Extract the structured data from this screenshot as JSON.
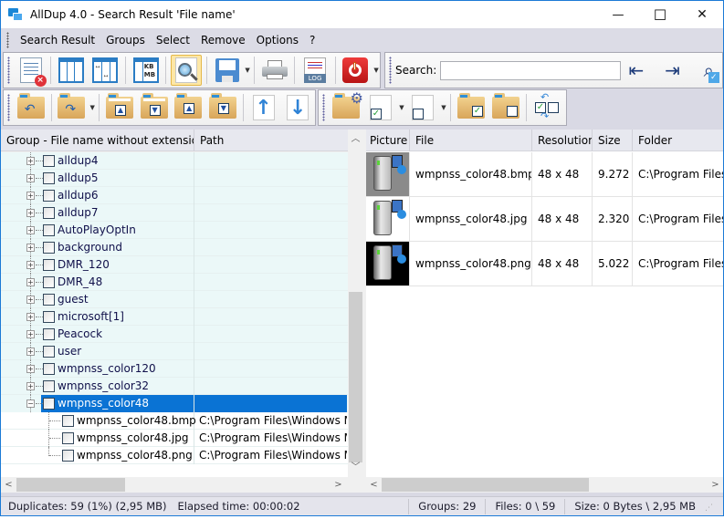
{
  "window": {
    "title": "AllDup 4.0 - Search Result 'File name'",
    "controls": {
      "minimize": "—",
      "maximize": "☐",
      "close": "✕"
    }
  },
  "menu": {
    "items": [
      "Search Result",
      "Groups",
      "Select",
      "Remove",
      "Options",
      "?"
    ]
  },
  "toolbar1": {
    "buttons": [
      {
        "name": "close-search-result",
        "icon": "document-delete-icon"
      },
      {
        "name": "columns",
        "icon": "columns-icon"
      },
      {
        "name": "auto-column-width",
        "icon": "column-width-icon"
      },
      {
        "name": "size-unit",
        "icon": "kb-mb-icon",
        "label_top": "KB",
        "label_bottom": "MB"
      },
      {
        "name": "preview",
        "icon": "magnifier-document-icon",
        "active": true
      },
      {
        "name": "save",
        "icon": "floppy-disk-icon",
        "dropdown": true
      },
      {
        "name": "print",
        "icon": "printer-icon"
      },
      {
        "name": "log",
        "icon": "log-icon",
        "label": "LOG"
      },
      {
        "name": "stop",
        "icon": "power-icon",
        "dropdown": true
      }
    ],
    "search_label": "Search:",
    "search_value": "",
    "search_buttons": [
      {
        "name": "find-previous",
        "icon": "binoculars-left-icon"
      },
      {
        "name": "find-next",
        "icon": "binoculars-right-icon"
      },
      {
        "name": "find-select",
        "icon": "binoculars-check-icon"
      }
    ]
  },
  "toolbar2": {
    "buttons": [
      {
        "name": "undo",
        "icon": "folder-undo-icon"
      },
      {
        "name": "redo",
        "icon": "folder-redo-icon",
        "dropdown": true
      },
      {
        "name": "first-group",
        "icon": "folder-first-icon"
      },
      {
        "name": "last-group",
        "icon": "folder-last-icon"
      },
      {
        "name": "previous-group",
        "icon": "folder-up-icon"
      },
      {
        "name": "next-group",
        "icon": "folder-down-icon"
      },
      {
        "name": "move-up",
        "icon": "arrow-up-icon"
      },
      {
        "name": "move-down",
        "icon": "arrow-down-icon"
      }
    ],
    "buttons2": [
      {
        "name": "group-settings",
        "icon": "folder-gear-icon"
      },
      {
        "name": "select-files",
        "icon": "file-check-icon",
        "dropdown": true
      },
      {
        "name": "deselect-files",
        "icon": "file-uncheck-icon",
        "dropdown": true
      },
      {
        "name": "select-all-groups",
        "icon": "folder-check-icon"
      },
      {
        "name": "deselect-all-groups",
        "icon": "folder-uncheck-icon"
      },
      {
        "name": "invert-selection",
        "icon": "invert-selection-icon"
      }
    ]
  },
  "left_pane": {
    "columns": [
      "Group - File name without extension",
      "Path"
    ],
    "groups": [
      {
        "label": "alldup4"
      },
      {
        "label": "alldup5"
      },
      {
        "label": "alldup6"
      },
      {
        "label": "alldup7"
      },
      {
        "label": "AutoPlayOptIn"
      },
      {
        "label": "background"
      },
      {
        "label": "DMR_120"
      },
      {
        "label": "DMR_48"
      },
      {
        "label": "guest"
      },
      {
        "label": "microsoft[1]"
      },
      {
        "label": "Peacock"
      },
      {
        "label": "user"
      },
      {
        "label": "wmpnss_color120"
      },
      {
        "label": "wmpnss_color32"
      },
      {
        "label": "wmpnss_color48",
        "expanded": true,
        "selected": true
      }
    ],
    "children": [
      {
        "label": "wmpnss_color48.bmp",
        "path": "C:\\Program Files\\Windows Me"
      },
      {
        "label": "wmpnss_color48.jpg",
        "path": "C:\\Program Files\\Windows Me"
      },
      {
        "label": "wmpnss_color48.png",
        "path": "C:\\Program Files\\Windows Me"
      }
    ]
  },
  "right_pane": {
    "columns": [
      "Picture",
      "File",
      "Resolution",
      "Size",
      "Folder"
    ],
    "rows": [
      {
        "file": "wmpnss_color48.bmp",
        "resolution": "48 x 48",
        "size": "9.272",
        "folder": "C:\\Program Files\\",
        "thumb_bg": "#8a8a8a"
      },
      {
        "file": "wmpnss_color48.jpg",
        "resolution": "48 x 48",
        "size": "2.320",
        "folder": "C:\\Program Files\\",
        "thumb_bg": "#ffffff"
      },
      {
        "file": "wmpnss_color48.png",
        "resolution": "48 x 48",
        "size": "5.022",
        "folder": "C:\\Program Files\\",
        "thumb_bg": "#000000"
      }
    ]
  },
  "status": {
    "duplicates": "Duplicates: 59 (1%) (2,95 MB)",
    "elapsed": "Elapsed time: 00:00:02",
    "groups": "Groups: 29",
    "files": "Files: 0 \\ 59",
    "size": "Size: 0 Bytes \\ 2,95 MB"
  },
  "colors": {
    "selection": "#0a73d4",
    "group_row_bg": "#ebf8f8",
    "window_border": "#1c7ad6"
  }
}
